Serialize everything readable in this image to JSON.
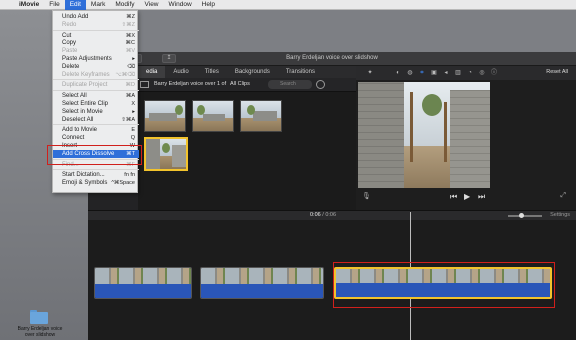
{
  "menubar": {
    "apple": "",
    "items": [
      "iMovie",
      "File",
      "Edit",
      "Mark",
      "Modify",
      "View",
      "Window",
      "Help"
    ],
    "active": "Edit"
  },
  "window": {
    "title": "Barry Erdeljan voice over slidshow",
    "back": "◂",
    "share": "↥"
  },
  "browser_tabs": [
    "edia",
    "Audio",
    "Titles",
    "Backgrounds",
    "Transitions"
  ],
  "library": {
    "project": "Barry Erdeljan voice over 1 of",
    "filter": "All Clips",
    "search_placeholder": "Search"
  },
  "viewer": {
    "reset_all": "Reset All",
    "tools": [
      "wand-icon",
      "color-balance-icon",
      "color-correction-icon",
      "crop-icon",
      "stabilization-icon",
      "volume-icon",
      "eq-icon",
      "speed-icon",
      "filter-icon",
      "info-icon"
    ]
  },
  "timeline": {
    "current": "0:06",
    "separator": "/",
    "total": "0:06",
    "settings": "Settings"
  },
  "desktop": {
    "folder_label": "Barry Erdeljan voice over slidshow"
  },
  "edit_menu": [
    {
      "label": "Undo Add",
      "shortcut": "⌘Z",
      "enabled": true
    },
    {
      "label": "Redo",
      "shortcut": "⇧⌘Z",
      "enabled": false
    },
    {
      "sep": true
    },
    {
      "label": "Cut",
      "shortcut": "⌘X",
      "enabled": true
    },
    {
      "label": "Copy",
      "shortcut": "⌘C",
      "enabled": true
    },
    {
      "label": "Paste",
      "shortcut": "⌘V",
      "enabled": false
    },
    {
      "label": "Paste Adjustments",
      "shortcut": "▸",
      "enabled": true
    },
    {
      "label": "Delete",
      "shortcut": "⌫",
      "enabled": true
    },
    {
      "label": "Delete Keyframes",
      "shortcut": "⌥⌘⌫",
      "enabled": false
    },
    {
      "sep": true
    },
    {
      "label": "Duplicate Project",
      "shortcut": "⌘D",
      "enabled": false
    },
    {
      "sep": true
    },
    {
      "label": "Select All",
      "shortcut": "⌘A",
      "enabled": true
    },
    {
      "label": "Select Entire Clip",
      "shortcut": "X",
      "enabled": true
    },
    {
      "label": "Select in Movie",
      "shortcut": "▸",
      "enabled": true
    },
    {
      "label": "Deselect All",
      "shortcut": "⇧⌘A",
      "enabled": true
    },
    {
      "sep": true
    },
    {
      "label": "Add to Movie",
      "shortcut": "E",
      "enabled": true
    },
    {
      "label": "Connect",
      "shortcut": "Q",
      "enabled": true
    },
    {
      "label": "Insert",
      "shortcut": "W",
      "enabled": true
    },
    {
      "label": "Add Cross Dissolve",
      "shortcut": "⌘T",
      "enabled": true,
      "highlighted": true
    },
    {
      "sep": true
    },
    {
      "label": "Find...",
      "shortcut": "⌘F",
      "enabled": false
    },
    {
      "sep": true
    },
    {
      "label": "Start Dictation...",
      "shortcut": "fn fn",
      "enabled": true
    },
    {
      "label": "Emoji & Symbols",
      "shortcut": "^⌘Space",
      "enabled": true
    }
  ],
  "colors": {
    "accent": "#2f6fd9",
    "selection": "#f2c32c",
    "annotation": "#d0201c",
    "audio": "#2a56b8"
  }
}
